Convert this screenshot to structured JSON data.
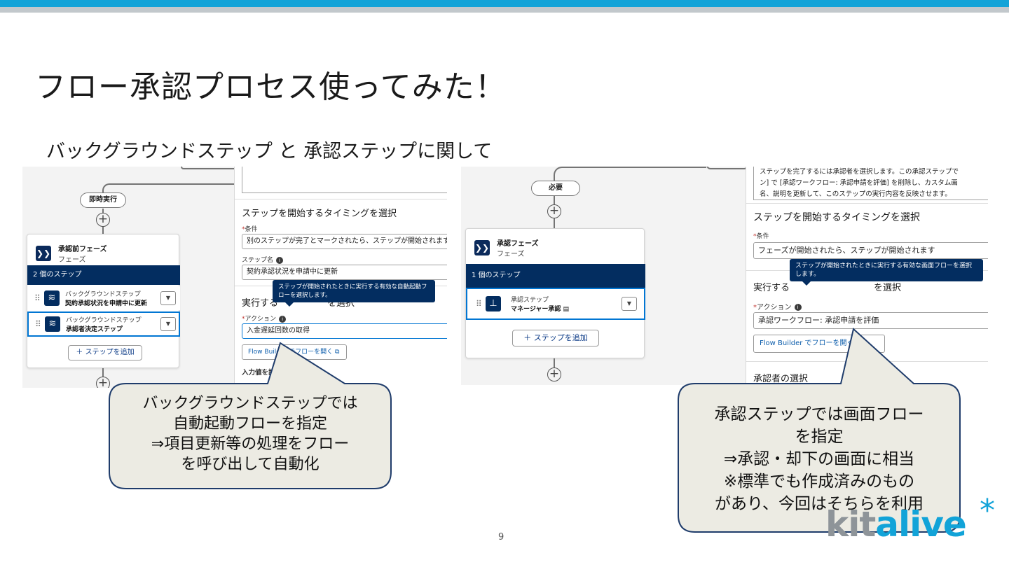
{
  "slide": {
    "title": "フロー承認プロセス使ってみた！",
    "subtitle": "バックグラウンドステップ と 承認ステップに関して",
    "page_number": "9"
  },
  "left": {
    "canvas": {
      "pill": "即時実行",
      "phase_name": "承認前フェーズ",
      "phase_type": "フェーズ",
      "steps_count": "2 個のステップ",
      "steps": [
        {
          "type": "バックグラウンドステップ",
          "name": "契約承認状況を申請中に更新"
        },
        {
          "type": "バックグラウンドステップ",
          "name": "承認者決定ステップ"
        }
      ],
      "add_step": "＋ ステップを追加"
    },
    "panel": {
      "timing_heading": "ステップを開始するタイミングを選択",
      "condition_label": "条件",
      "condition_value": "別のステップが完了とマークされたら、ステップが開始されます",
      "step_name_label": "ステップ名",
      "step_name_value": "契約承認状況を申請中に更新",
      "exec_heading": "実行する",
      "exec_heading_tail": "を選択",
      "tooltip": "ステップが開始されたときに実行する有効な自動起動フローを選択します。",
      "action_label": "アクション",
      "action_value": "入金遅延回数の取得",
      "open_button": "Flow Builder でフローを開く",
      "input_values": "入力値を設定"
    },
    "callout": [
      "バックグラウンドステップでは",
      "自動起動フローを指定",
      "⇒項目更新等の処理をフロー",
      "を呼び出して自動化"
    ]
  },
  "right": {
    "canvas": {
      "pill": "必要",
      "phase_name": "承認フェーズ",
      "phase_type": "フェーズ",
      "steps_count": "1 個のステップ",
      "step_type": "承認ステップ",
      "step_name": "マネージャー承認",
      "add_step": "＋ ステップを追加"
    },
    "panel": {
      "desc_line1": "ステップを完了するには承認者を選択します。この承認ステップで",
      "desc_line2": "ン] で [承認ワークフロー: 承認申請を評価] を削除し、カスタム画",
      "desc_line3": "名、説明を更新して、このステップの実行内容を反映させます。",
      "timing_heading": "ステップを開始するタイミングを選択",
      "condition_label": "条件",
      "condition_value": "フェーズが開始されたら、ステップが開始されます",
      "exec_heading": "実行する",
      "exec_heading_tail": "を選択",
      "tooltip": "ステップが開始されたときに実行する有効な画面フローを選択します。",
      "action_label": "アクション",
      "action_value": "承認ワークフロー: 承認申請を評価",
      "open_button": "Flow Builder でフローを開く",
      "approver_heading": "承認者の選択"
    },
    "callout": [
      "承認ステップでは画面フロー",
      "を指定",
      "⇒承認・却下の画面に相当",
      "※標準でも作成済みのもの",
      "があり、今回はそちらを利用"
    ]
  },
  "logo": {
    "part1": "kit",
    "part2": "alive",
    "mark": "*"
  },
  "colors": {
    "accent": "#12a3d8",
    "navy": "#032d60",
    "callout_fill": "#ecebe3",
    "callout_stroke": "#1f3c6b"
  }
}
